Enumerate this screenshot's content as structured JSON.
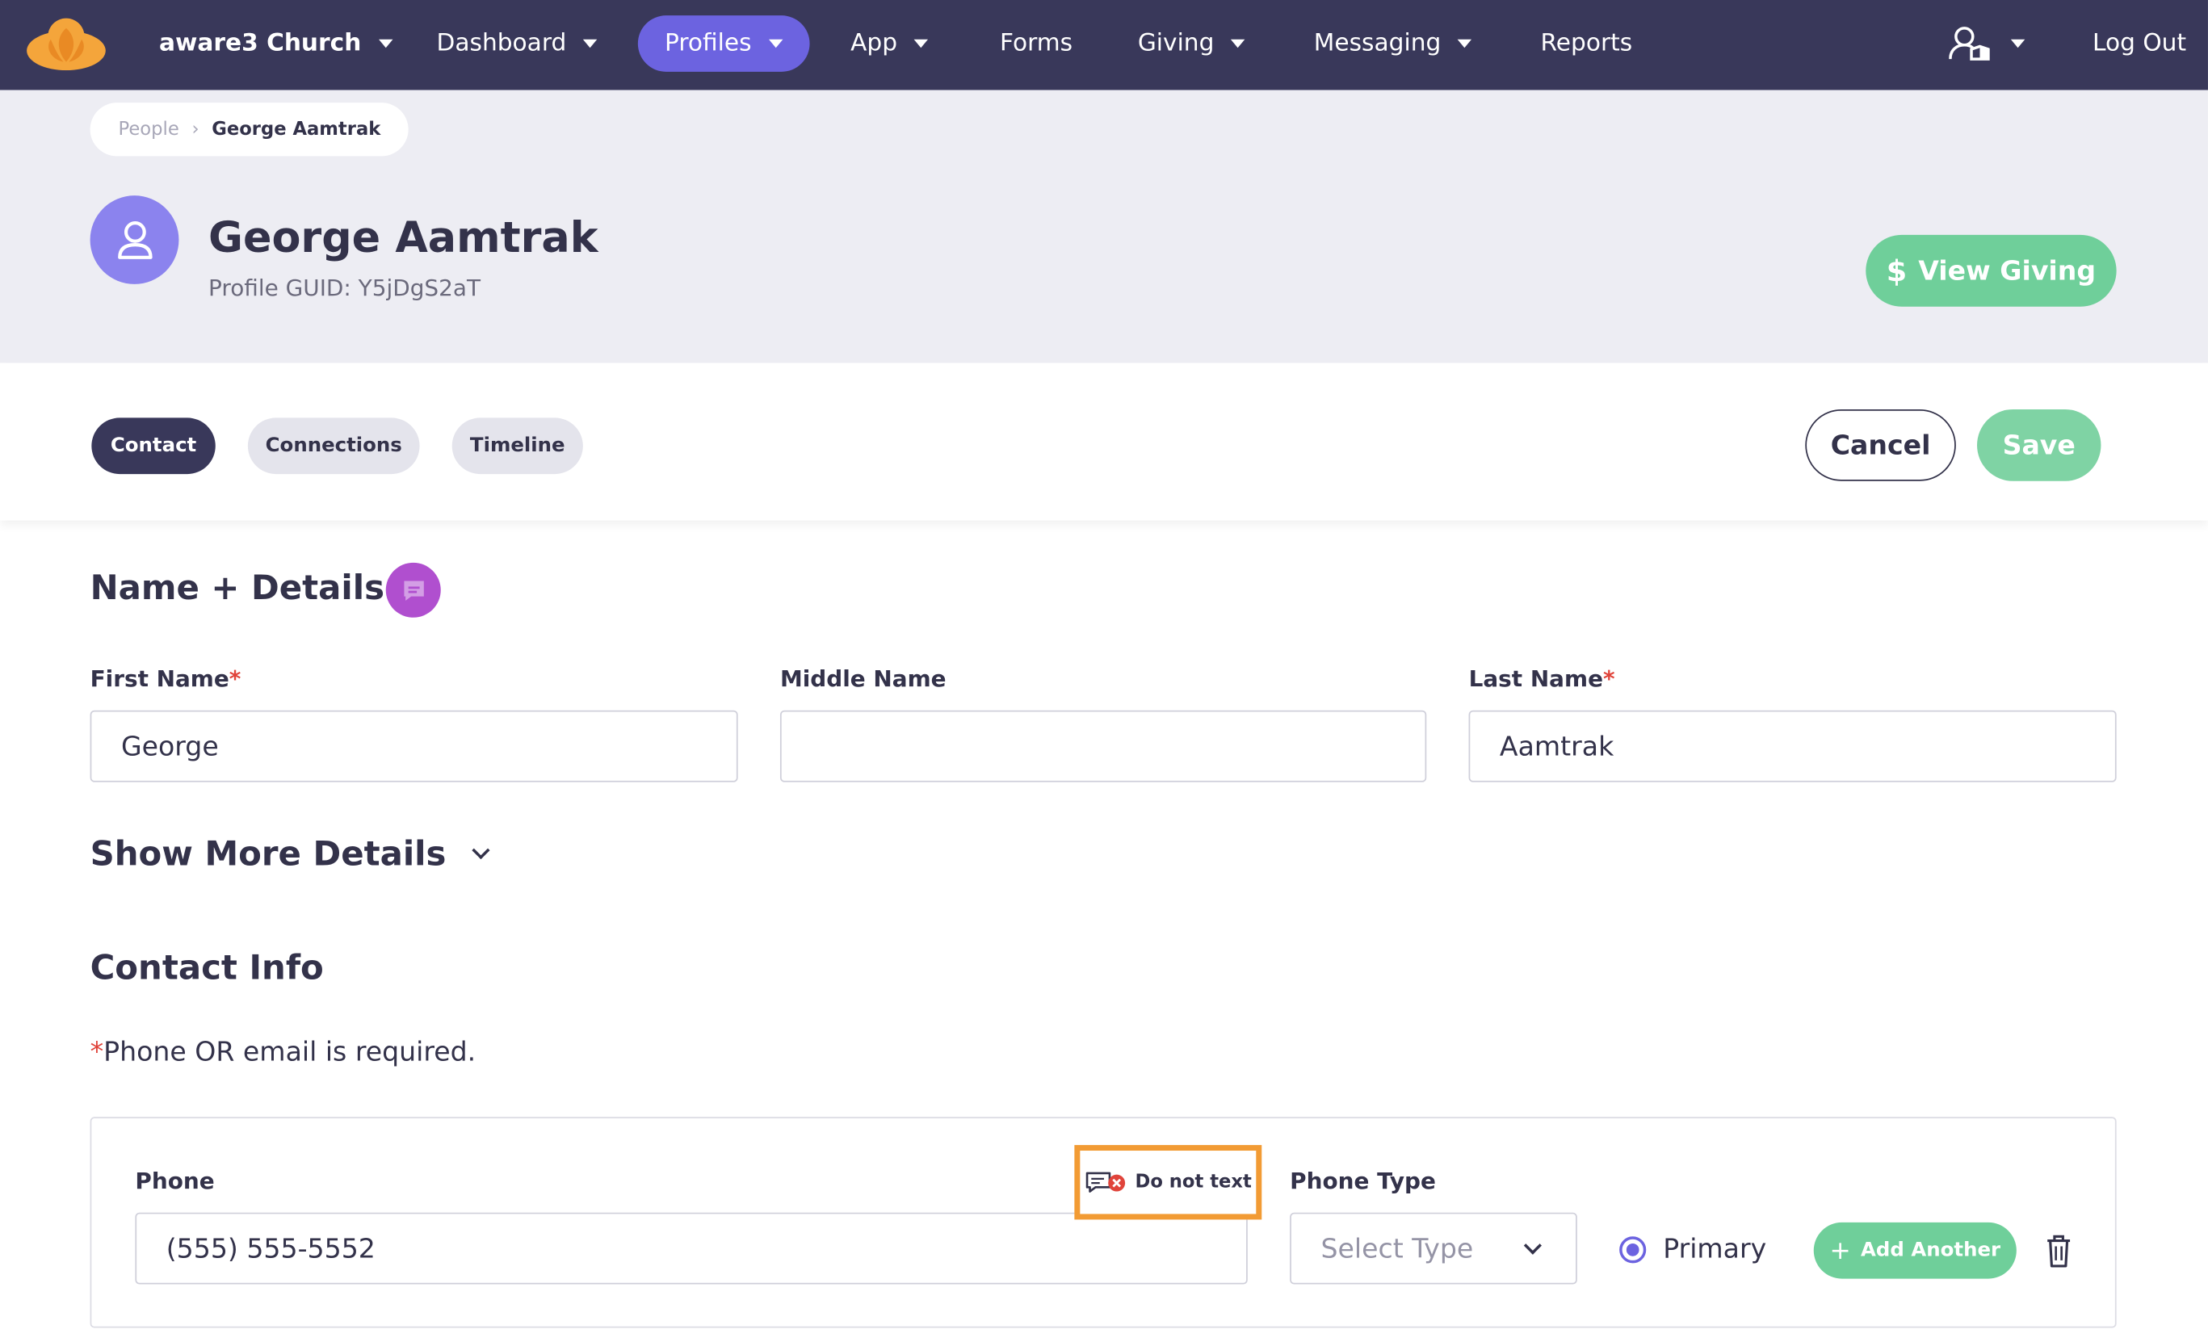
{
  "nav": {
    "org": "aware3 Church",
    "items": [
      {
        "label": "Dashboard"
      },
      {
        "label": "Profiles"
      },
      {
        "label": "App"
      },
      {
        "label": "Forms"
      },
      {
        "label": "Giving"
      },
      {
        "label": "Messaging"
      },
      {
        "label": "Reports"
      }
    ],
    "logout": "Log Out",
    "user_icon": "user-shield-icon",
    "brand_color": "#39385a",
    "accent_color": "#6c63e0"
  },
  "breadcrumb": {
    "parent": "People",
    "current": "George Aamtrak"
  },
  "profile": {
    "name": "George Aamtrak",
    "guid": "Profile GUID: Y5jDgS2aT",
    "view_giving": "View Giving",
    "giving_symbol": "$"
  },
  "tabs": [
    {
      "label": "Contact",
      "active": true
    },
    {
      "label": "Connections",
      "active": false
    },
    {
      "label": "Timeline",
      "active": false
    }
  ],
  "actions": {
    "cancel": "Cancel",
    "save": "Save",
    "success_color": "#6fcf9a"
  },
  "name_details": {
    "title": "Name + Details",
    "first_name_label": "First Name",
    "first_name_value": "George",
    "middle_name_label": "Middle Name",
    "middle_name_value": "",
    "last_name_label": "Last Name",
    "last_name_value": "Aamtrak",
    "required_mark": "*",
    "show_more": "Show More Details"
  },
  "contact_info": {
    "title": "Contact Info",
    "required_mark": "*",
    "required_note": "Phone OR email is required.",
    "phone_label": "Phone",
    "phone_value": "(555) 555-5552",
    "do_not_text": "Do not text",
    "phone_type_label": "Phone Type",
    "phone_type_placeholder": "Select Type",
    "primary_label": "Primary",
    "primary_selected": true,
    "add_another": "Add Another",
    "highlight_color": "#f29b34"
  }
}
